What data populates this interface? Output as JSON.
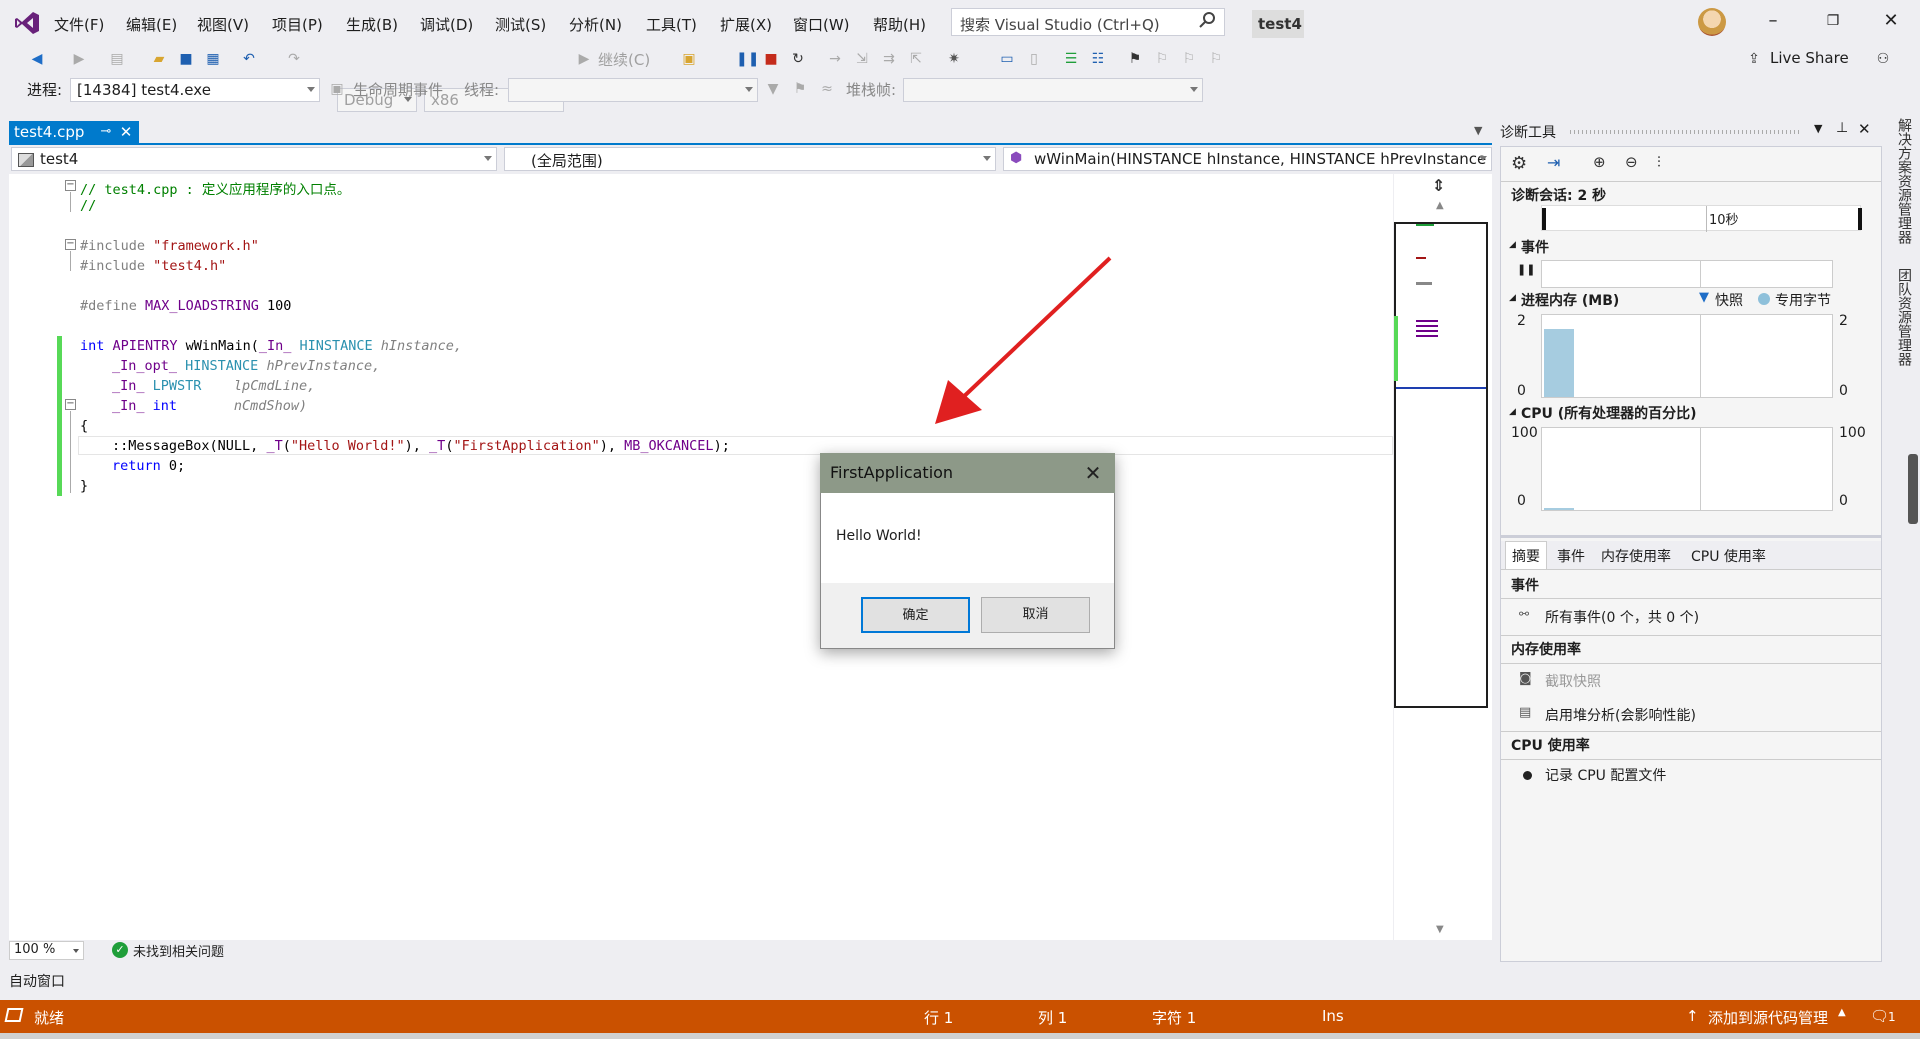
{
  "menubar": {
    "items": [
      "文件(F)",
      "编辑(E)",
      "视图(V)",
      "项目(P)",
      "生成(B)",
      "调试(D)",
      "测试(S)",
      "分析(N)",
      "工具(T)",
      "扩展(X)",
      "窗口(W)",
      "帮助(H)"
    ],
    "search_placeholder": "搜索 Visual Studio (Ctrl+Q)",
    "solution_title": "test4",
    "live_share": "Live Share"
  },
  "toolbar": {
    "config": "Debug",
    "platform": "x86",
    "continue_label": "继续(C)",
    "process_label": "进程:",
    "process_value": "[14384] test4.exe",
    "lifecycle_label": "生命周期事件",
    "thread_label": "线程:",
    "stackframe_label": "堆栈帧:"
  },
  "editor": {
    "tab_label": "test4.cpp",
    "project_combo": "test4",
    "scope_combo": "(全局范围)",
    "function_combo": "wWinMain(HINSTANCE hInstance, HINSTANCE hPrevInstance",
    "zoom": "100 %",
    "issues": "未找到相关问题"
  },
  "auto_window": "自动窗口",
  "statusbar": {
    "ready": "就绪",
    "line": "行 1",
    "col": "列 1",
    "char": "字符 1",
    "mode": "Ins",
    "source_control": "添加到源代码管理",
    "notifications": "1"
  },
  "diagnostics": {
    "title": "诊断工具",
    "session": "诊断会话: 2 秒",
    "timeline_tick": "10秒",
    "events_label": "事件",
    "memory_label": "进程内存 (MB)",
    "legend_snapshot": "快照",
    "legend_private": "专用字节",
    "mem_max": "2",
    "mem_min": "0",
    "cpu_label": "CPU (所有处理器的百分比)",
    "cpu_max": "100",
    "cpu_min": "0",
    "tabs": [
      "摘要",
      "事件",
      "内存使用率",
      "CPU 使用率"
    ],
    "sec_events": "事件",
    "all_events": "所有事件(0 个，共 0 个)",
    "sec_memory": "内存使用率",
    "take_snapshot": "截取快照",
    "heap_profiling": "启用堆分析(会影响性能)",
    "sec_cpu": "CPU 使用率",
    "record_cpu": "记录 CPU 配置文件",
    "memory_fraction": 0.83
  },
  "right_rail": {
    "solution_explorer": "解决方案资源管理器",
    "team_explorer": "团队资源管理器"
  },
  "dialog": {
    "title": "FirstApplication",
    "message": "Hello World!",
    "ok": "确定",
    "cancel": "取消"
  },
  "code": {
    "line1_comment": "// test4.cpp : 定义应用程序的入口点。",
    "line2_comment": "//",
    "include1_kw": "#include ",
    "include1_str": "\"framework.h\"",
    "include2_kw": "#include ",
    "include2_str": "\"test4.h\"",
    "define_kw": "#define ",
    "define_name": "MAX_LOADSTRING",
    "define_val": " 100",
    "fn_int": "int",
    "fn_apientry": " APIENTRY ",
    "fn_name": "wWinMain",
    "fn_paren": "(",
    "p1_ann": "_In_",
    "p1_type": " HINSTANCE",
    "p1_name": " hInstance,",
    "p2_ann": "_In_opt_",
    "p2_type": " HINSTANCE",
    "p2_name": " hPrevInstance,",
    "p3_ann": "_In_",
    "p3_type": " LPWSTR",
    "p3_name": "    lpCmdLine,",
    "p4_ann": "_In_",
    "p4_type": " int",
    "p4_name": "       nCmdShow)",
    "brace_open": "{",
    "call_ns": "::",
    "call_fn": "MessageBox",
    "call_a": "(NULL, ",
    "call_t1": "_T",
    "call_s1": "\"Hello World!\"",
    "call_b": "), ",
    "call_t2": "_T",
    "call_s2": "\"FirstApplication\"",
    "call_c": "), ",
    "call_mac": "MB_OKCANCEL",
    "call_end": ");",
    "return_kw": "return",
    "return_val": " 0;",
    "brace_close": "}"
  }
}
